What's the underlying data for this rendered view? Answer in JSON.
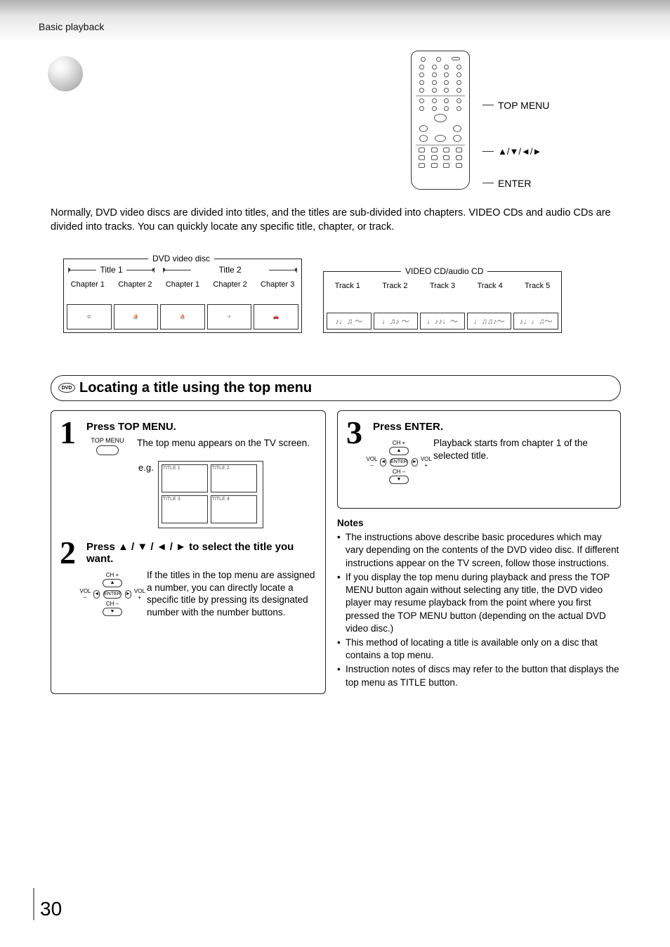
{
  "header": {
    "section": "Basic playback"
  },
  "remote_labels": {
    "top_menu": "TOP MENU",
    "arrows": "▲/▼/◄/►",
    "enter": "ENTER"
  },
  "intro": "Normally, DVD video discs are divided into titles, and the titles are sub-divided into chapters. VIDEO CDs and audio CDs are divided into tracks. You can quickly locate any specific title, chapter, or track.",
  "structure": {
    "dvd": {
      "label": "DVD video disc",
      "titles": [
        "Title 1",
        "Title 2"
      ],
      "chapters_t1": [
        "Chapter 1",
        "Chapter 2"
      ],
      "chapters_t2": [
        "Chapter 1",
        "Chapter 2",
        "Chapter 3"
      ]
    },
    "cd": {
      "label": "VIDEO CD/audio CD",
      "tracks": [
        "Track 1",
        "Track 2",
        "Track 3",
        "Track 4",
        "Track 5"
      ]
    }
  },
  "section": {
    "badge": "DVD",
    "title": "Locating a title using the top menu"
  },
  "steps": {
    "s1": {
      "num": "1",
      "head": "Press TOP MENU.",
      "btn_label": "TOP MENU",
      "desc": "The top menu appears on the TV screen.",
      "eg": "e.g.",
      "titles": [
        "TITLE 1",
        "TITLE 2",
        "TITLE 3",
        "TITLE 4"
      ]
    },
    "s2": {
      "num": "2",
      "head_a": "Press ",
      "head_arrows": "▲ / ▼ / ◄ / ►",
      "head_b": " to select the title you want.",
      "cluster": {
        "chp": "CH +",
        "chm": "CH –",
        "volm": "VOL –",
        "volp": "VOL +",
        "enter": "ENTER"
      },
      "desc": "If the titles in the top menu are assigned a number, you can directly locate a specific title by pressing its designated number with the number buttons."
    },
    "s3": {
      "num": "3",
      "head": "Press ENTER.",
      "cluster": {
        "chp": "CH +",
        "chm": "CH –",
        "volm": "VOL –",
        "volp": "VOL +",
        "enter": "ENTER"
      },
      "desc": "Playback starts from chapter 1 of the selected title."
    }
  },
  "notes": {
    "head": "Notes",
    "items": [
      "The instructions above describe basic procedures which may vary depending on the contents of the DVD video disc. If different instructions appear on the TV screen, follow those instructions.",
      "If you display the top menu during playback and press the TOP MENU button again without selecting any title, the DVD video player may resume playback from the point where you first pressed the TOP MENU button (depending on the actual DVD video disc.)",
      "This method of locating a title is available only on a disc that contains a top menu.",
      "Instruction notes of discs may refer to the button that displays the top menu as TITLE button."
    ]
  },
  "page_number": "30"
}
